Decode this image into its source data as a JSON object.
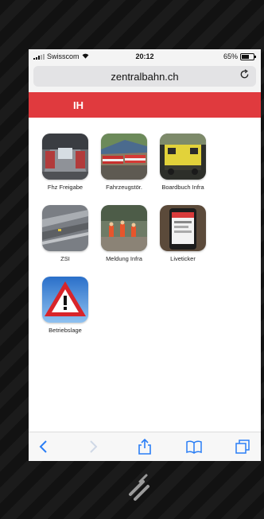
{
  "status_bar": {
    "carrier": "Swisscom",
    "time": "20:12",
    "battery": "65%"
  },
  "address_bar": {
    "url": "zentralbahn.ch"
  },
  "header": {
    "title": "IH",
    "color": "#e03a3e"
  },
  "tiles": [
    {
      "label": "Fhz Freigabe",
      "icon": "train-interior-icon"
    },
    {
      "label": "Fahrzeugstör.",
      "icon": "trains-in-depot-icon"
    },
    {
      "label": "Boardbuch Infra",
      "icon": "yellow-locomotive-icon"
    },
    {
      "label": "ZSI",
      "icon": "rail-track-icon"
    },
    {
      "label": "Meldung Infra",
      "icon": "track-workers-icon"
    },
    {
      "label": "Liveticker",
      "icon": "phone-screen-icon"
    },
    {
      "label": "Betriebslage",
      "icon": "warning-sign-icon"
    }
  ],
  "toolbar": {
    "back": "back-icon",
    "forward": "forward-icon",
    "share": "share-icon",
    "bookmarks": "bookmarks-icon",
    "tabs": "tabs-icon"
  }
}
